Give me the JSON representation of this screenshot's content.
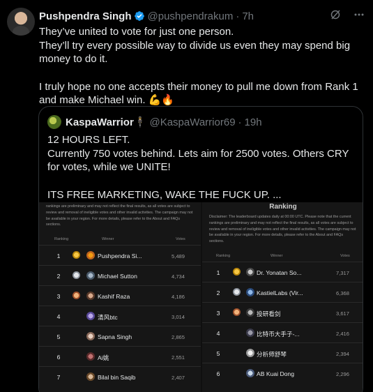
{
  "tweet": {
    "author_name": "Pushpendra Singh",
    "author_handle": "@pushpendrakum",
    "separator": "·",
    "time": "7h",
    "lines": [
      "They’ve united to vote for just one person.",
      "They’ll try every possible way to divide us even they may spend big money to do it.",
      "I truly hope no one accepts their money to pull me down from Rank 1 and make Michael win. 💪🔥"
    ]
  },
  "quote": {
    "author_name": "KaspaWarrior🕴",
    "author_handle": "@KaspaWarrior69",
    "separator": "·",
    "time": "19h",
    "lines": [
      "12 HOURS LEFT.",
      "Currently 750 votes behind. Lets aim for 2500 votes. Others CRY for votes, while we UNITE!",
      "ITS FREE MARKETING, WAKE THE FUCK UP. ..."
    ]
  },
  "left_board": {
    "note": "rankings are preliminary and may not reflect the final results, as all votes are subject to review and removal of ineligible votes and other invalid activities. The campaign may not be available in your region. For more details, please refer to the About and FAQs sections.",
    "col_rank": "Ranking",
    "col_winner": "Winner",
    "col_votes": "Votes",
    "rows": [
      {
        "rank": "1",
        "name": "Pushpendra Si...",
        "votes": "5,489"
      },
      {
        "rank": "2",
        "name": "Michael Sutton",
        "votes": "4,734"
      },
      {
        "rank": "3",
        "name": "Kashif Raza",
        "votes": "4,186"
      },
      {
        "rank": "4",
        "name": "清风btc",
        "votes": "3,014"
      },
      {
        "rank": "5",
        "name": "Sapna Singh",
        "votes": "2,865"
      },
      {
        "rank": "6",
        "name": "Ai姚",
        "votes": "2,551"
      },
      {
        "rank": "7",
        "name": "Bilal bin Saqib",
        "votes": "2,407"
      }
    ]
  },
  "right_board": {
    "title": "Ranking",
    "note": "Disclaimer: The leaderboard updates daily at 00:00 UTC. Please note that the current rankings are preliminary and may not reflect the final results, as all votes are subject to review and removal of ineligible votes and other invalid activities. The campaign may not be available in your region. For more details, please refer to the About and FAQs sections.",
    "col_rank": "Ranking",
    "col_winner": "Winner",
    "col_votes": "Votes",
    "rows": [
      {
        "rank": "1",
        "name": "Dr. Yonatan So...",
        "votes": "7,317"
      },
      {
        "rank": "2",
        "name": "KastielLabs (Vir...",
        "votes": "6,368"
      },
      {
        "rank": "3",
        "name": "投研看剑",
        "votes": "3,617"
      },
      {
        "rank": "4",
        "name": "比特币大手子-...",
        "votes": "2,416"
      },
      {
        "rank": "5",
        "name": "分析师舒琴",
        "votes": "2,394"
      },
      {
        "rank": "6",
        "name": "AB Kuai Dong",
        "votes": "2,296"
      }
    ]
  },
  "colors": {
    "background": "#000000",
    "text": "#e7e9ea",
    "muted": "#71767b",
    "verified": "#1d9bf0",
    "border": "#2f3336"
  }
}
